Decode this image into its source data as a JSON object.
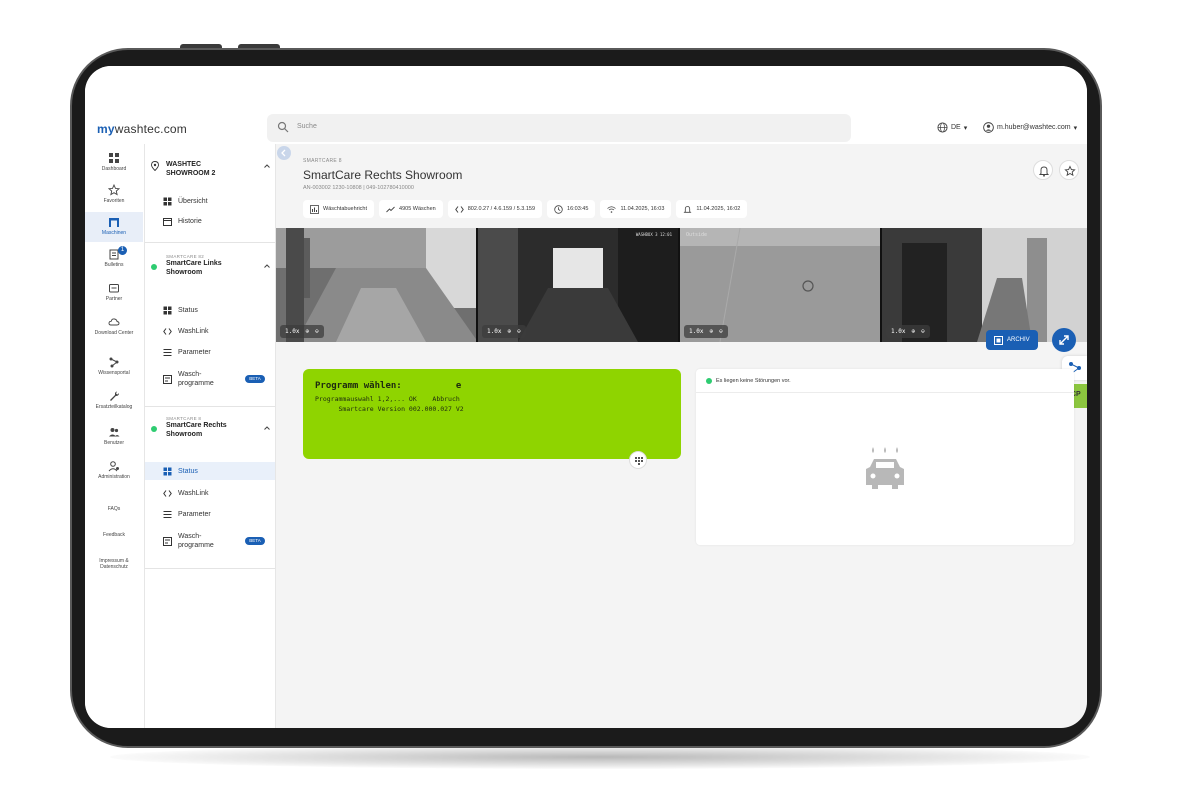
{
  "app": {
    "logo_prefix": "my",
    "logo_rest": "washtec.com"
  },
  "search": {
    "placeholder": "Suche"
  },
  "header": {
    "language": "DE",
    "user": "m.huber@washtec.com"
  },
  "rail": [
    {
      "label": "Dashboard",
      "icon": "grid-icon"
    },
    {
      "label": "Favoriten",
      "icon": "star-icon"
    },
    {
      "label": "Maschinen",
      "icon": "machine-icon",
      "active": true
    },
    {
      "label": "Bulletins",
      "icon": "bulletin-icon",
      "badge": "1"
    },
    {
      "label": "Partner",
      "icon": "partner-icon"
    },
    {
      "label": "Download Center",
      "icon": "cloud-icon"
    },
    {
      "label": "Wissensportal",
      "icon": "network-icon"
    },
    {
      "label": "Ersatzteilkatalog",
      "icon": "wrench-icon"
    },
    {
      "label": "Benutzer",
      "icon": "users-icon"
    },
    {
      "label": "Administration",
      "icon": "admin-icon"
    },
    {
      "label": "FAQs",
      "icon": ""
    },
    {
      "label": "Feedback",
      "icon": ""
    },
    {
      "label": "Impressum & Datenschutz",
      "icon": ""
    }
  ],
  "tree": {
    "location": {
      "title": "WASHTEC SHOWROOM 2",
      "items": [
        "Übersicht",
        "Historie"
      ]
    },
    "machine1": {
      "sub": "SMARTCARE 82",
      "title": "SmartCare Links Showroom",
      "items": [
        "Status",
        "WashLink",
        "Parameter",
        "Wasch-programme"
      ],
      "beta": "BETA"
    },
    "machine2": {
      "sub": "SMARTCARE 8",
      "title": "SmartCare Rechts Showroom",
      "items": [
        "Status",
        "WashLink",
        "Parameter",
        "Wasch-programme"
      ],
      "beta": "BETA"
    }
  },
  "main": {
    "crumb": "SMARTCARE 8",
    "title": "SmartCare Rechts Showroom",
    "id": "AN-003002 1230-10808 | 049-102780410000",
    "chips": [
      {
        "icon": "chart-icon",
        "label": "Wäschtabuehricht"
      },
      {
        "icon": "trend-icon",
        "label": "4905 Wäschen"
      },
      {
        "icon": "code-icon",
        "label": "802.0.27 / 4.6.159 / 5.3.159"
      },
      {
        "icon": "clock-icon",
        "label": "16:03:45"
      },
      {
        "icon": "wifi-icon",
        "label": "11.04.2025, 16:03"
      },
      {
        "icon": "bell-icon",
        "label": "11.04.2025, 16:02"
      }
    ],
    "cams": [
      {
        "zoom": "1.0x",
        "ts": ""
      },
      {
        "zoom": "1.0x",
        "ts": "WASHBOX 3 12:01"
      },
      {
        "zoom": "1.0x",
        "ts": "Outside"
      },
      {
        "zoom": "1.0x",
        "ts": ""
      }
    ],
    "archive_label": "ARCHIV",
    "side_tab": "CP",
    "display": {
      "line1": "Programm wählen:          e",
      "line2": "Programmauswahl 1,2,... OK    Abbruch",
      "line3": "      Smartcare Version 002.000.027 V2"
    },
    "faults": {
      "title": "Es liegen keine Störungen vor."
    }
  },
  "colors": {
    "brand": "#1a5fb4",
    "display_green": "#8fd400",
    "ok_green": "#2ecc71"
  }
}
